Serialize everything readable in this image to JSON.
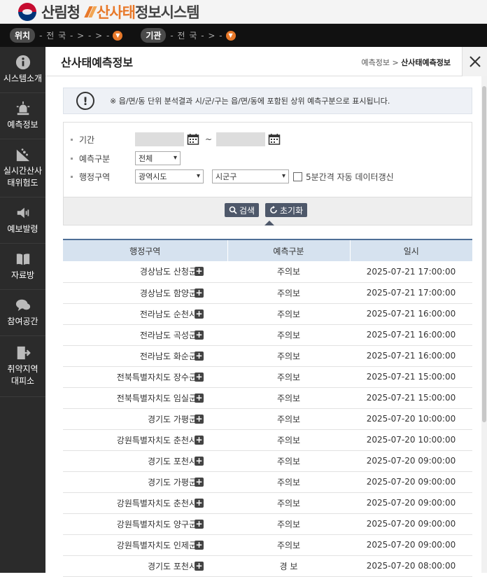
{
  "brand": {
    "org": "산림청",
    "sys_highlight": "산사태",
    "sys_rest": "정보시스템"
  },
  "location_bar": {
    "loc_label": "위치",
    "loc_value": "- 전 국 - > - > -",
    "agency_label": "기관",
    "agency_value": "- 전 국 - > -"
  },
  "sidebar": {
    "items": [
      {
        "label": "시스템소개",
        "icon": "info-icon"
      },
      {
        "label": "예측정보",
        "icon": "siren-icon"
      },
      {
        "label": "실시간산사\n태위험도",
        "icon": "landslide-icon"
      },
      {
        "label": "예보발령",
        "icon": "speaker-icon"
      },
      {
        "label": "자료방",
        "icon": "book-icon"
      },
      {
        "label": "참여공간",
        "icon": "chat-icon"
      },
      {
        "label": "취약지역\n대피소",
        "icon": "exit-icon"
      }
    ]
  },
  "header": {
    "title": "산사태예측정보",
    "breadcrumb_parent": "예측정보",
    "breadcrumb_sep": ">",
    "breadcrumb_current": "산사태예측정보"
  },
  "notice": {
    "text": "※ 읍/면/동 단위 분석결과 시/군/구는 읍/면/동에 포함된 상위 예측구분으로 표시됩니다."
  },
  "filter": {
    "period_label": "기간",
    "period_sep": "~",
    "forecast_label": "예측구분",
    "forecast_value": "전체",
    "region_label": "행정구역",
    "province_value": "광역시도",
    "district_value": "시군구",
    "auto_refresh_label": "5분간격 자동 데이터갱신",
    "search_button": "검색",
    "reset_button": "초기화"
  },
  "table": {
    "headers": [
      "행정구역",
      "예측구분",
      "일시"
    ],
    "rows": [
      [
        "경상남도 산청군",
        "주의보",
        "2025-07-21 17:00:00"
      ],
      [
        "경상남도 함양군",
        "주의보",
        "2025-07-21 17:00:00"
      ],
      [
        "전라남도 순천시",
        "주의보",
        "2025-07-21 16:00:00"
      ],
      [
        "전라남도 곡성군",
        "주의보",
        "2025-07-21 16:00:00"
      ],
      [
        "전라남도 화순군",
        "주의보",
        "2025-07-21 16:00:00"
      ],
      [
        "전북특별자치도 장수군",
        "주의보",
        "2025-07-21 15:00:00"
      ],
      [
        "전북특별자치도 임실군",
        "주의보",
        "2025-07-21 15:00:00"
      ],
      [
        "경기도 가평군",
        "주의보",
        "2025-07-20 10:00:00"
      ],
      [
        "강원특별자치도 춘천시",
        "주의보",
        "2025-07-20 10:00:00"
      ],
      [
        "경기도 포천시",
        "주의보",
        "2025-07-20 09:00:00"
      ],
      [
        "경기도 가평군",
        "주의보",
        "2025-07-20 09:00:00"
      ],
      [
        "강원특별자치도 춘천시",
        "주의보",
        "2025-07-20 09:00:00"
      ],
      [
        "강원특별자치도 양구군",
        "주의보",
        "2025-07-20 09:00:00"
      ],
      [
        "강원특별자치도 인제군",
        "주의보",
        "2025-07-20 09:00:00"
      ],
      [
        "경기도 포천시",
        "경 보",
        "2025-07-20 08:00:00"
      ]
    ]
  },
  "colors": {
    "accent": "#e8792a",
    "header_bg": "#d6e2ef",
    "button": "#4e586a"
  }
}
